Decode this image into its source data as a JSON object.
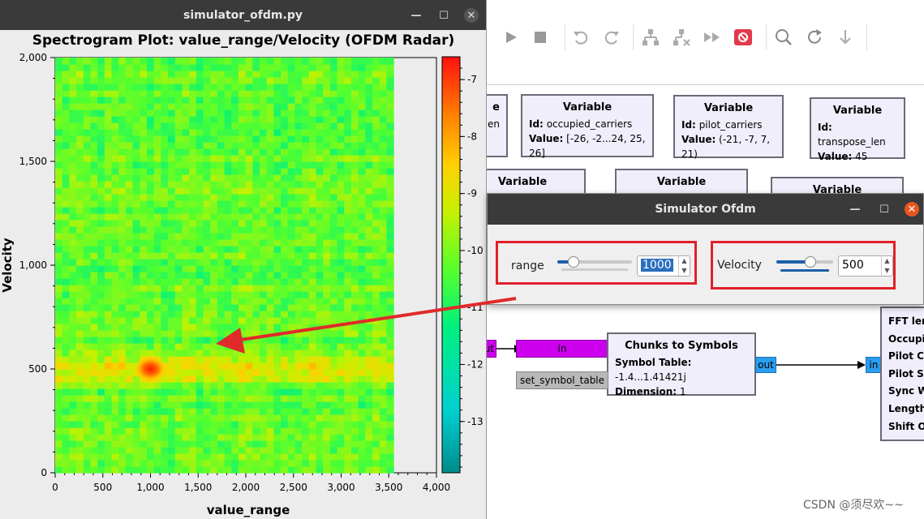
{
  "plot_window": {
    "title": "simulator_ofdm.py",
    "plot_title": "Spectrogram Plot: value_range/Velocity (OFDM Radar)",
    "xlabel": "value_range",
    "ylabel": "Velocity",
    "x_ticks": [
      "0",
      "500",
      "1,000",
      "1,500",
      "2,000",
      "2,500",
      "3,000",
      "3,500",
      "4,000"
    ],
    "y_ticks": [
      "2,000",
      "1,500",
      "1,000",
      "500",
      "0"
    ],
    "colorbar_ticks": [
      "-7",
      "-8",
      "-9",
      "-10",
      "-11",
      "-12",
      "-13"
    ]
  },
  "chart_data": {
    "type": "heatmap",
    "title": "Spectrogram Plot: value_range/Velocity (OFDM Radar)",
    "xlabel": "value_range",
    "ylabel": "Velocity",
    "xlim": [
      0,
      4000
    ],
    "ylim": [
      0,
      2000
    ],
    "data_extent_x": [
      0,
      3550
    ],
    "colorbar_range": [
      -13.9,
      -6.6
    ],
    "background_level": -10.3,
    "peak": {
      "x": 1000,
      "y": 500,
      "value": -7
    },
    "band": {
      "y": 500,
      "x_range": [
        0,
        3550
      ]
    }
  },
  "sim_window": {
    "title": "Simulator Ofdm",
    "range_label": "range",
    "range_value": "1000",
    "velocity_label": "Velocity",
    "velocity_value": "500",
    "range_slider_fraction": 0.22,
    "velocity_slider_fraction": 0.6
  },
  "grc": {
    "variables": [
      {
        "title": "Variable",
        "id": "occupied_carriers",
        "value": "[-26, -2...24, 25, 26]"
      },
      {
        "title": "Variable",
        "id": "pilot_carriers",
        "value": "(-21, -7, 7, 21)"
      },
      {
        "title": "Variable",
        "id": "transpose_len",
        "value": "45"
      }
    ],
    "partial_left_block": {
      "title": "e",
      "line": "len"
    },
    "row2_titles": [
      "Variable",
      "Variable",
      "Variable"
    ],
    "chunks_block": {
      "title": "Chunks to Symbols",
      "symbol_table_label": "Symbol Table:",
      "symbol_table_value": "-1.4...1.41421j",
      "dimension_label": "Dimension:",
      "dimension_value": "1"
    },
    "in_port": "in",
    "out_port": "out",
    "partial_out": "ut",
    "in_port_right": "in",
    "set_symbol_table": "set_symbol_table",
    "right_block_params": [
      "FFT leng",
      "Occupie",
      "Pilot Ca",
      "Pilot Sy",
      "Sync Wo",
      "Length t",
      "Shift Ou"
    ]
  },
  "watermark": "CSDN @须尽欢~~"
}
